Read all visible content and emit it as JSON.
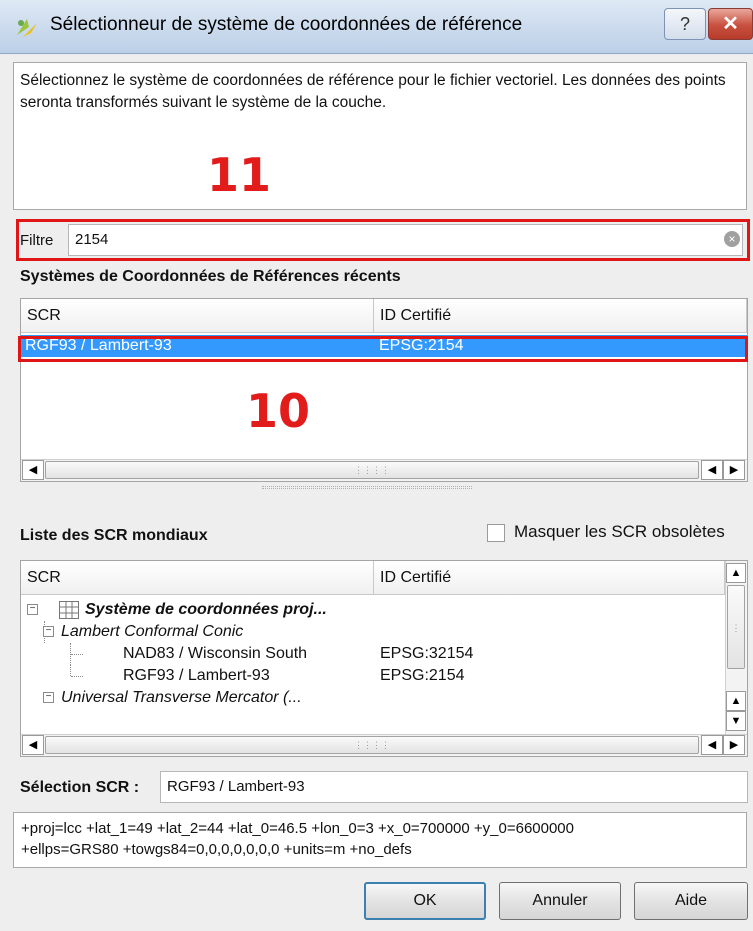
{
  "window": {
    "title": "Sélectionneur de système de coordonnées de référence",
    "help_label": "?",
    "close_label": "✕"
  },
  "info_text": "Sélectionnez le système de coordonnées de référence pour le fichier vectoriel. Les données des points seronta transformés suivant le système de la couche.",
  "annotations": {
    "a11": "11",
    "a10": "10"
  },
  "filter": {
    "label": "Filtre",
    "value": "2154"
  },
  "recent": {
    "title": "Systèmes de Coordonnées de Références récents",
    "columns": [
      "SCR",
      "ID Certifié"
    ],
    "rows": [
      {
        "name": "RGF93 / Lambert-93",
        "id": "EPSG:2154"
      }
    ]
  },
  "world": {
    "title": "Liste des SCR mondiaux",
    "hide_obsolete_label": "Masquer les SCR obsolètes",
    "hide_obsolete_checked": false,
    "columns": [
      "SCR",
      "ID Certifié"
    ],
    "tree": {
      "root": "Système de coordonnées proj...",
      "group1": "Lambert Conformal Conic",
      "item1_name": "NAD83 / Wisconsin South",
      "item1_id": "EPSG:32154",
      "item2_name": "RGF93 / Lambert-93",
      "item2_id": "EPSG:2154",
      "group2": "Universal Transverse Mercator (..."
    }
  },
  "selection": {
    "label": "Sélection SCR :",
    "value": "RGF93 / Lambert-93"
  },
  "proj_string": {
    "line1": "+proj=lcc +lat_1=49 +lat_2=44 +lat_0=46.5 +lon_0=3 +x_0=700000 +y_0=6600000",
    "line2": "+ellps=GRS80 +towgs84=0,0,0,0,0,0,0 +units=m +no_defs"
  },
  "buttons": {
    "ok": "OK",
    "cancel": "Annuler",
    "help": "Aide"
  },
  "colors": {
    "selection": "#3399ff",
    "annotation": "#e21b1b"
  }
}
